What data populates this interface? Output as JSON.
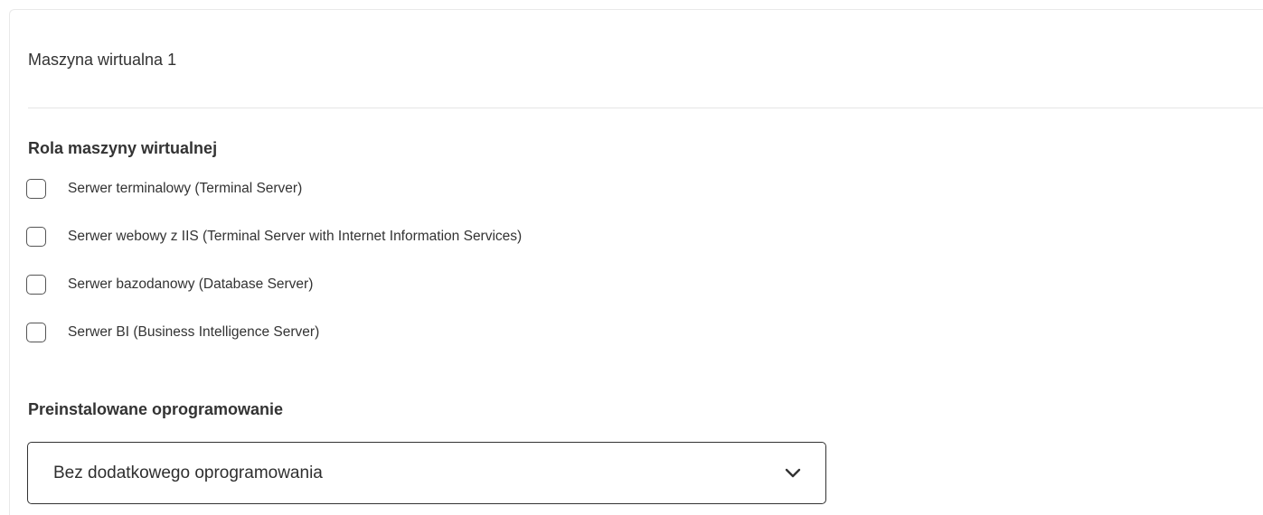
{
  "card": {
    "title": "Maszyna wirtualna 1"
  },
  "role": {
    "label": "Rola maszyny wirtualnej",
    "options": [
      {
        "label": "Serwer terminalowy (Terminal Server)",
        "checked": false
      },
      {
        "label": "Serwer webowy z IIS (Terminal Server with Internet Information Services)",
        "checked": false
      },
      {
        "label": "Serwer bazodanowy (Database Server)",
        "checked": false
      },
      {
        "label": "Serwer BI (Business Intelligence Server)",
        "checked": false
      }
    ]
  },
  "software": {
    "label": "Preinstalowane oprogramowanie",
    "selected": "Bez dodatkowego oprogramowania",
    "icon": "chevron-down-icon"
  }
}
